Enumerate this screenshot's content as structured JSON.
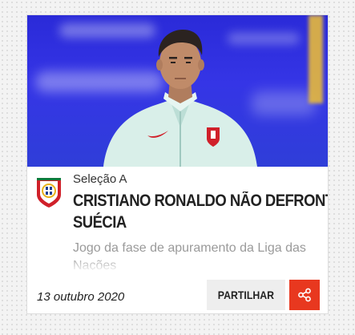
{
  "card": {
    "kicker": "Seleção A",
    "headline_line1": "CRISTIANO RONALDO NÃO DEFRONTA",
    "headline_line2": "SUÉCIA",
    "excerpt": "Jogo da fase de apuramento da Liga das Nações",
    "date": "13 outubro 2020",
    "share_label": "PARTILHAR"
  },
  "colors": {
    "accent": "#e8381f",
    "crest_green": "#0b7a3b",
    "crest_red": "#d0202a"
  },
  "icons": {
    "crest": "fpf-crest-icon",
    "share": "share-icon"
  }
}
